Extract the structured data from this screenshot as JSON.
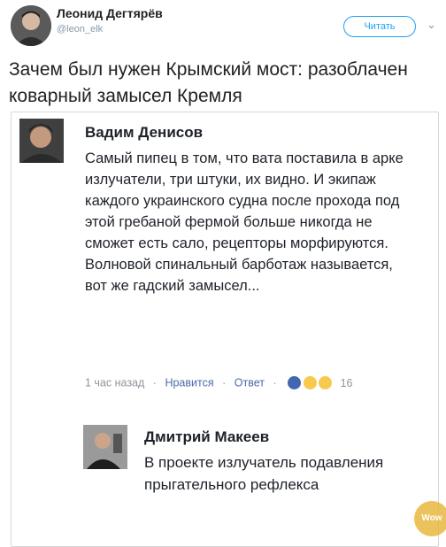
{
  "tweet": {
    "author_name": "Леонид Дегтярёв",
    "author_handle": "@leon_elk",
    "follow_label": "Читать",
    "text": "Зачем был нужен Крымский мост: разоблачен коварный замысел Кремля"
  },
  "comments": [
    {
      "author": "Вадим Денисов",
      "text": "Самый пипец в том, что вата поставила в арке излучатели, три штуки, их видно. И экипаж каждого украинского судна после прохода под этой гребаной фермой больше никогда не сможет есть сало, рецепторы морфируются. Волновой спинальный барботаж называется, вот же гадский замысел...",
      "time": "1 час назад",
      "like_label": "Нравится",
      "reply_label": "Ответ",
      "reaction_count": "16",
      "reactions": [
        "like-icon",
        "haha-icon",
        "wow-icon"
      ]
    }
  ],
  "reply": {
    "author": "Дмитрий Макеев",
    "text": "В проекте излучатель подавления прыгательного рефлекса"
  },
  "colors": {
    "link": "#4b6aa8",
    "twitter_blue": "#1da1f2",
    "meta_gray": "#90949c"
  }
}
